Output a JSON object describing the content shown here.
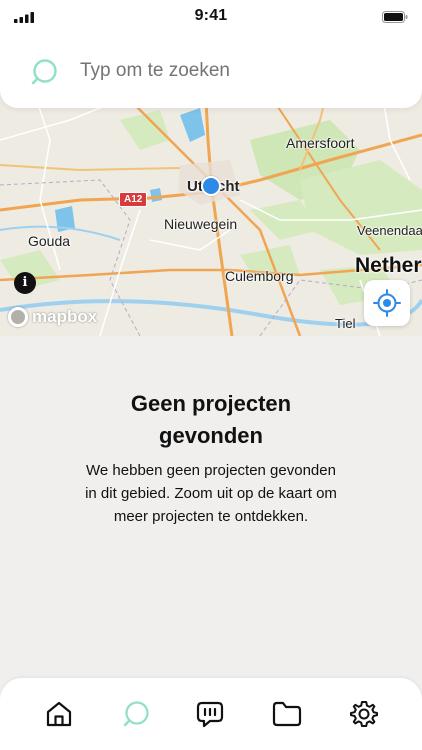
{
  "status_bar": {
    "time": "9:41"
  },
  "search": {
    "placeholder": "Typ om te zoeken",
    "value": ""
  },
  "map": {
    "labels": {
      "amersfoort": "Amersfoort",
      "utrecht": "Utrecht",
      "nieuwegein": "Nieuwegein",
      "gouda": "Gouda",
      "veenendaal": "Veenendaal",
      "culemborg": "Culemborg",
      "netherlands": "Nether",
      "tiel": "Tiel"
    },
    "road_shield": "A12",
    "attribution": "mapbox",
    "info_symbol": "i"
  },
  "empty_state": {
    "title_line1": "Geen projecten",
    "title_line2": "gevonden",
    "body": "We hebben geen projecten gevonden in dit gebied. Zoom uit op de kaart om meer projecten te ontdekken."
  },
  "tabs": [
    {
      "icon": "home-icon",
      "active": false
    },
    {
      "icon": "search-icon",
      "active": true
    },
    {
      "icon": "chat-icon",
      "active": false
    },
    {
      "icon": "folder-icon",
      "active": false
    },
    {
      "icon": "gear-icon",
      "active": false
    }
  ],
  "colors": {
    "accent": "#8fe0c4",
    "background": "#f0efed",
    "map_location": "#2e8ae6"
  }
}
